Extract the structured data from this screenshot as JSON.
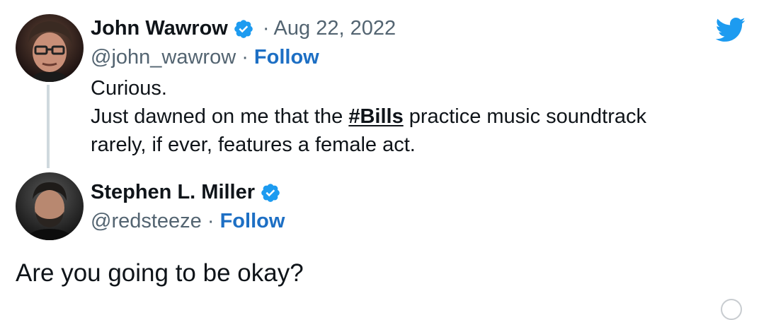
{
  "tweet1": {
    "display_name": "John Wawrow",
    "verified_icon": "verified-badge-icon",
    "separator": "·",
    "date": "Aug 22, 2022",
    "handle": "@john_wawrow",
    "handle_separator": " · ",
    "follow_label": "Follow",
    "text": {
      "line1": "Curious.",
      "line2_before": "Just dawned on me that the ",
      "hashtag": "#Bills",
      "line2_after": " practice music soundtrack",
      "line3": "rarely, if ever, features a female act."
    }
  },
  "tweet2": {
    "display_name": "Stephen L. Miller",
    "verified_icon": "verified-badge-icon",
    "handle": "@redsteeze",
    "handle_separator": " · ",
    "follow_label": "Follow",
    "text": "Are you going to be okay?"
  },
  "brand": {
    "icon": "twitter-bird-icon",
    "color": "#1d9bf0"
  },
  "colors": {
    "link": "#1d6fc4",
    "secondary_text": "#536471",
    "primary_text": "#0f1419",
    "thread_line": "#cfd9de"
  }
}
